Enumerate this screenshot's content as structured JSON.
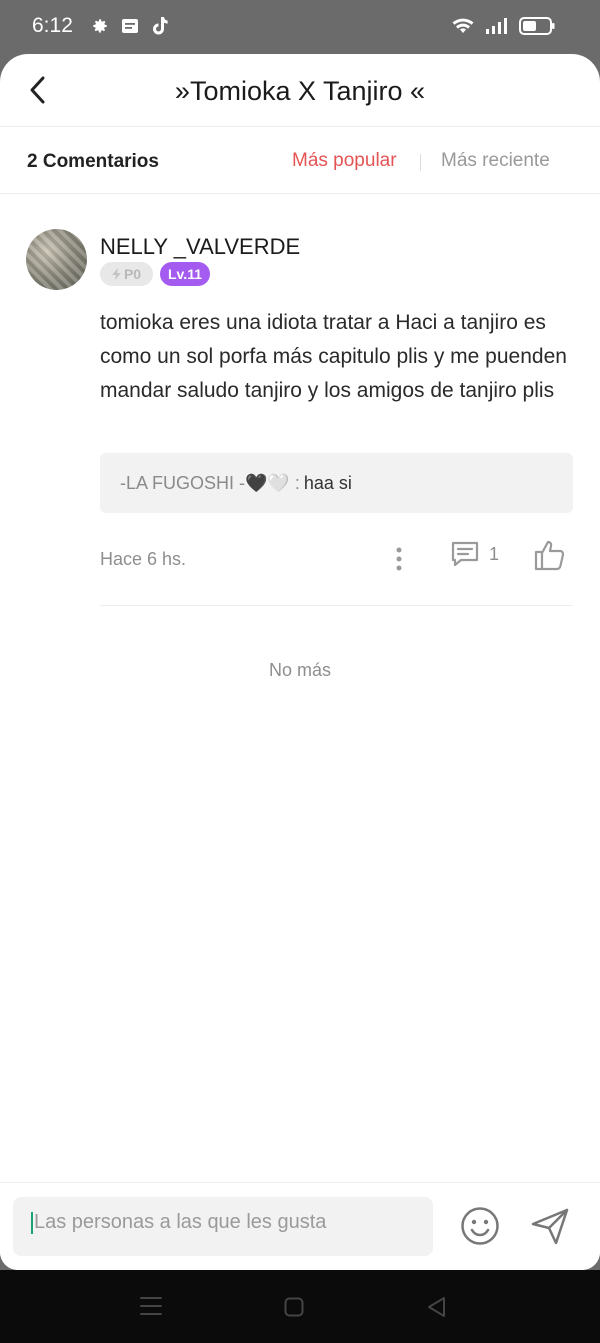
{
  "status_bar": {
    "time": "6:12",
    "left_icons": [
      "gear-icon",
      "message-icon",
      "tiktok-icon"
    ],
    "right_icons": [
      "wifi-icon",
      "signal-icon",
      "battery-icon"
    ]
  },
  "header": {
    "title": "»Tomioka X Tanjiro «"
  },
  "sort_bar": {
    "count_label": "2 Comentarios",
    "popular_label": "Más popular",
    "recent_label": "Más reciente",
    "active_color": "#e45454"
  },
  "comments": [
    {
      "username": "NELLY _VALVERDE",
      "points_badge": "P0",
      "level_badge": "Lv.11",
      "level_color": "#a45bf0",
      "text": "tomioka eres una idiota tratar a Haci a tanjiro es como un sol  porfa más capitulo plis y me puenden mandar saludo tanjiro y los amigos de tanjiro plis",
      "reply": {
        "author": "-LA FUGOSHI -🖤🤍 :",
        "text": "haa si"
      },
      "time": "Hace 6 hs.",
      "reply_count": "1"
    }
  ],
  "footer_text": "No más",
  "input": {
    "placeholder": "Las personas a las que les gusta"
  }
}
